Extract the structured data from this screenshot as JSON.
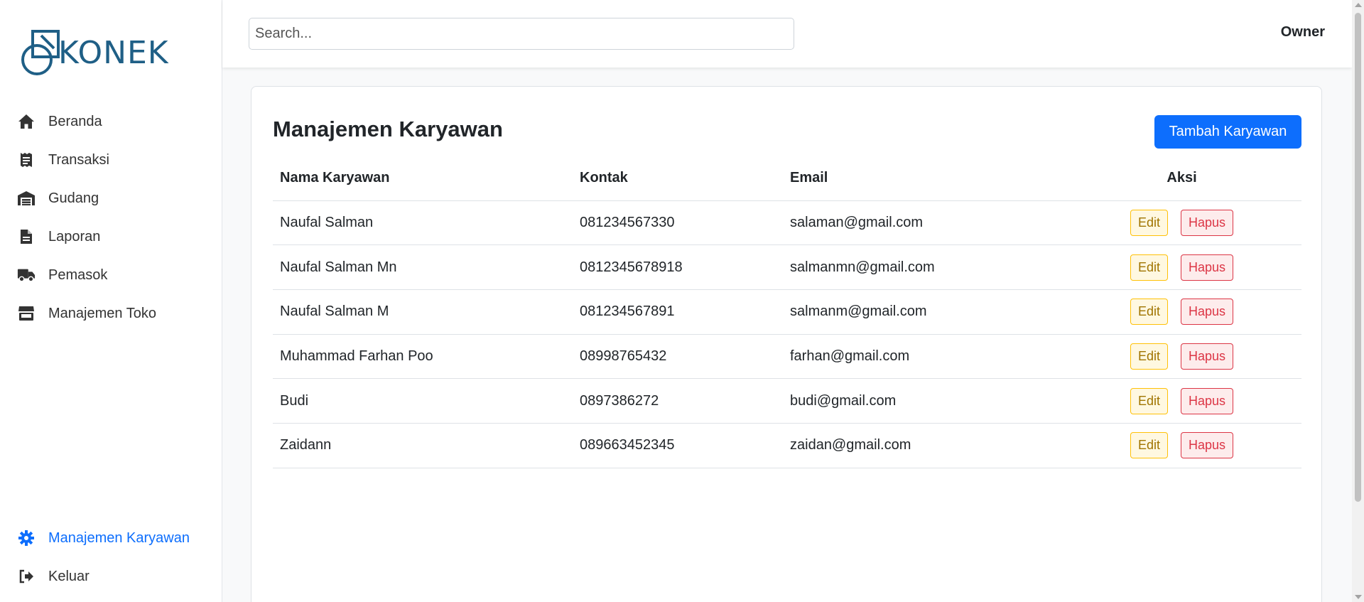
{
  "brand": {
    "name": "KONEK",
    "color": "#1f5f86"
  },
  "sidebar": {
    "items": [
      {
        "label": "Beranda",
        "icon": "home-icon"
      },
      {
        "label": "Transaksi",
        "icon": "receipt-icon"
      },
      {
        "label": "Gudang",
        "icon": "warehouse-icon"
      },
      {
        "label": "Laporan",
        "icon": "file-icon"
      },
      {
        "label": "Pemasok",
        "icon": "truck-icon"
      },
      {
        "label": "Manajemen Toko",
        "icon": "store-icon"
      }
    ],
    "bottom_items": [
      {
        "label": "Manajemen Karyawan",
        "icon": "gear-icon",
        "active": true
      },
      {
        "label": "Keluar",
        "icon": "logout-icon"
      }
    ]
  },
  "header": {
    "search_placeholder": "Search...",
    "user": "Owner"
  },
  "main": {
    "title": "Manajemen Karyawan",
    "add_button": "Tambah Karyawan",
    "table": {
      "columns": [
        "Nama Karyawan",
        "Kontak",
        "Email",
        "Aksi"
      ],
      "rows": [
        {
          "name": "Naufal Salman",
          "contact": "081234567330",
          "email": "salaman@gmail.com"
        },
        {
          "name": "Naufal Salman Mn",
          "contact": "0812345678918",
          "email": "salmanmn@gmail.com"
        },
        {
          "name": "Naufal Salman M",
          "contact": "081234567891",
          "email": "salmanm@gmail.com"
        },
        {
          "name": "Muhammad Farhan Poo",
          "contact": "08998765432",
          "email": "farhan@gmail.com"
        },
        {
          "name": "Budi",
          "contact": "0897386272",
          "email": "budi@gmail.com"
        },
        {
          "name": "Zaidann",
          "contact": "089663452345",
          "email": "zaidan@gmail.com"
        }
      ],
      "edit_label": "Edit",
      "delete_label": "Hapus"
    }
  },
  "colors": {
    "primary": "#0d6efd",
    "warning": "#ffc107",
    "danger": "#dc3545"
  }
}
